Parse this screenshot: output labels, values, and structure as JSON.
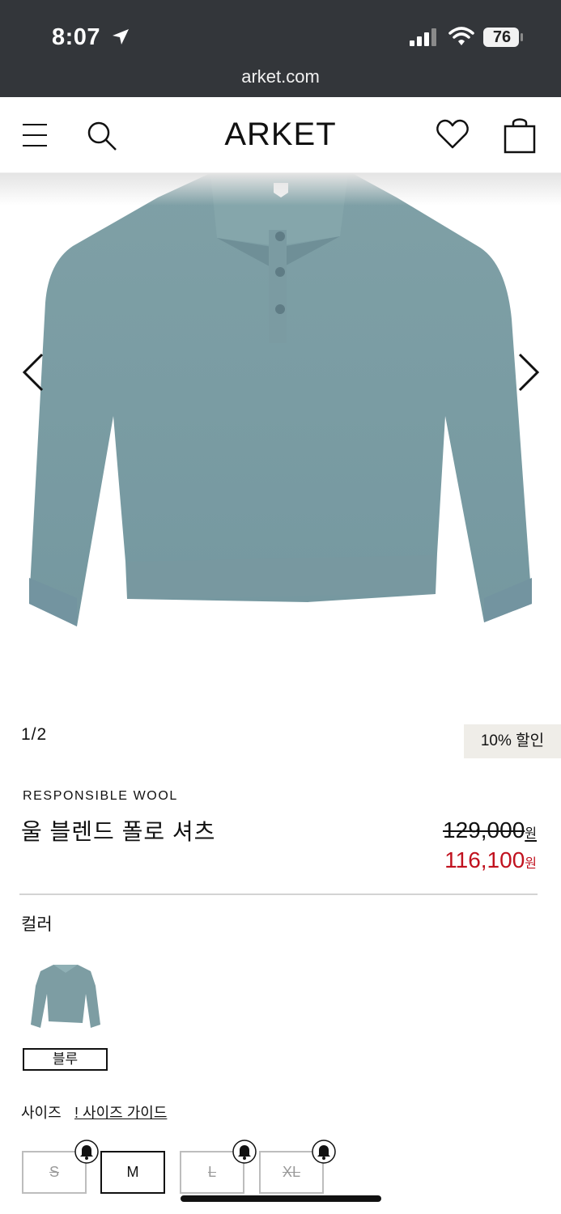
{
  "status_bar": {
    "time": "8:07",
    "battery": "76"
  },
  "browser": {
    "url": "arket.com"
  },
  "header": {
    "logo": "ARKET"
  },
  "gallery": {
    "pager": "1/2"
  },
  "product": {
    "discount_badge": "10% 할인",
    "collection": "RESPONSIBLE WOOL",
    "name": "울 블렌드 폴로 셔츠",
    "price_original": "129,000",
    "price_sale": "116,100",
    "currency": "원",
    "color_label": "컬러",
    "color_name": "블루",
    "size_label": "사이즈",
    "size_guide_marker": "!",
    "size_guide": "사이즈 가이드",
    "sizes": [
      {
        "label": "S",
        "available": false
      },
      {
        "label": "M",
        "available": true
      },
      {
        "label": "L",
        "available": false
      },
      {
        "label": "XL",
        "available": false
      }
    ]
  },
  "colors": {
    "sale_price": "#c1121f",
    "sweater": "#7d9da3",
    "status_bar_bg": "#33363a",
    "badge_bg": "#efede8"
  }
}
